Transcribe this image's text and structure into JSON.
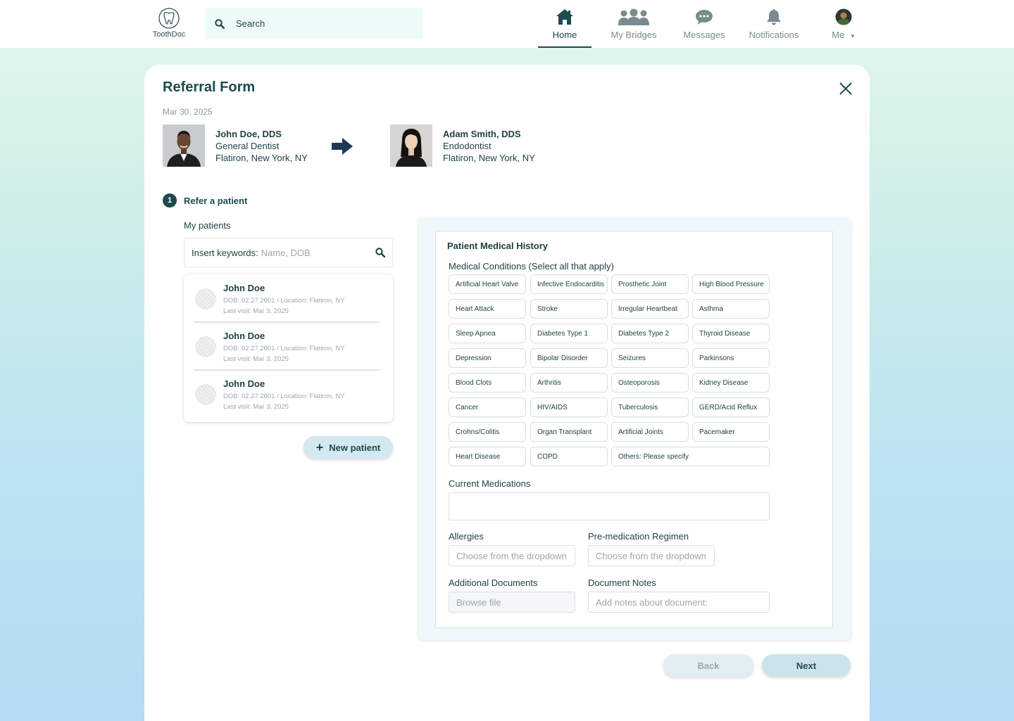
{
  "nav": {
    "logo_text": "ToothDoc",
    "search_placeholder": "Search",
    "items": [
      {
        "label": "Home",
        "icon": "home-icon",
        "active": true
      },
      {
        "label": "My Bridges",
        "icon": "people-icon",
        "active": false
      },
      {
        "label": "Messages",
        "icon": "chat-bubble-icon",
        "active": false
      },
      {
        "label": "Notifications",
        "icon": "bell-icon",
        "active": false
      },
      {
        "label": "Me",
        "icon": "avatar",
        "active": false
      }
    ]
  },
  "form": {
    "title": "Referral Form",
    "date": "Mar 30, 2025",
    "from_doctor": {
      "name": "John Doe, DDS",
      "specialty": "General Dentist",
      "location": "Flatiron, New York, NY"
    },
    "to_doctor": {
      "name": "Adam Smith, DDS",
      "specialty": "Endodontist",
      "location": "Flatiron, New York, NY"
    },
    "step": {
      "number": "1",
      "label": "Refer a patient"
    },
    "my_patients_label": "My patients",
    "keyword_label": "Insert keywords:",
    "keyword_placeholder": "Name, DOB",
    "patients": [
      {
        "name": "John Doe",
        "dob": "DOB: 02.27.2001 / Location: Flatiron, NY",
        "last_visit": "Last visit: Mar 3, 2025"
      },
      {
        "name": "John Doe",
        "dob": "DOB: 02.27.2001 / Location: Flatiron, NY",
        "last_visit": "Last visit: Mar 3, 2025"
      },
      {
        "name": "John Doe",
        "dob": "DOB: 02.27.2001 / Location: Flatiron, NY",
        "last_visit": "Last visit: Mar 3, 2025"
      }
    ],
    "new_patient_label": "New patient",
    "medical_history": {
      "title": "Patient Medical History",
      "conditions_label": "Medical Conditions (Select all that apply)",
      "conditions": [
        "Artificial Heart Valve",
        "Infective Endocarditis",
        "Prosthetic Joint",
        "High Blood Pressure",
        "Heart Attack",
        "Stroke",
        "Irregular Heartbeat",
        "Asthma",
        "Sleep Apnea",
        "Diabetes Type 1",
        "Diabetes Type 2",
        "Thyroid Disease",
        "Depression",
        "Bipolar Disorder",
        "Seizures",
        "Parkinsons",
        "Blood Clots",
        "Arthritis",
        "Osteoporosis",
        "Kidney Disease",
        "Cancer",
        "HIV/AIDS",
        "Tuberculosis",
        "GERD/Acid Reflux",
        "Crohns/Colitis",
        "Organ Transplant",
        "Artificial Joints",
        "Pacemaker",
        "Heart Disease",
        "COPD",
        "Others: Please specify"
      ],
      "current_medications_label": "Current Medications",
      "current_medications_value": "",
      "allergies_label": "Allergies",
      "allergies_placeholder": "Choose from the dropdown",
      "premed_label": "Pre-medication Regimen",
      "premed_placeholder": "Choose from the dropdown",
      "additional_docs_label": "Additional Documents",
      "additional_docs_placeholder": "Browse file",
      "doc_notes_label": "Document Notes",
      "doc_notes_placeholder": "Add notes about document:"
    },
    "back_label": "Back",
    "next_label": "Next"
  },
  "colors": {
    "primary": "#1d4a4f",
    "muted": "#9aa8ac",
    "accent_bg": "#cde3ec"
  }
}
